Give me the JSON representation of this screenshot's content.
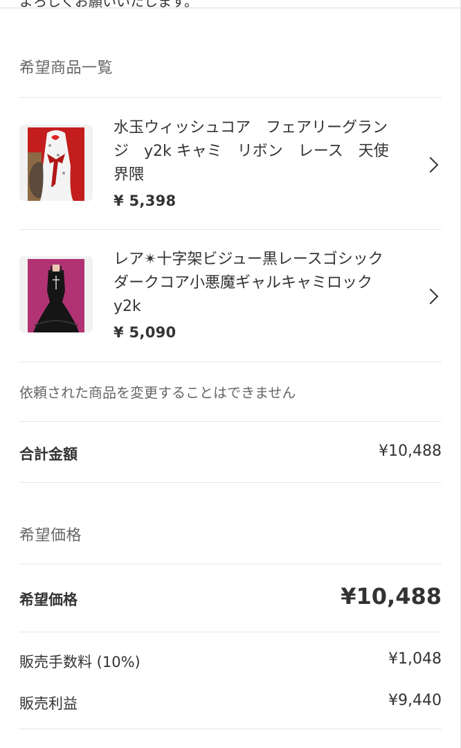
{
  "header": {
    "cut_text": "よろしくお願いいたします。"
  },
  "wishlist": {
    "title": "希望商品一覧",
    "items": [
      {
        "name": "水玉ウィッシュコア　フェアリーグランジ　y2k キャミ　リボン　レース　天使界隈",
        "price": "¥ 5,398"
      },
      {
        "name": "レア✴︎十字架ビジュー黒レースゴシックダークコア小悪魔ギャルキャミロック y2k",
        "price": "¥ 5,090"
      }
    ],
    "note": "依頼された商品を変更することはできません"
  },
  "total": {
    "label": "合計金額",
    "value": "¥10,488"
  },
  "price_section": {
    "title": "希望価格",
    "desired_label": "希望価格",
    "desired_value": "¥10,488",
    "fee_label": "販売手数料 (10%)",
    "fee_value": "¥1,048",
    "profit_label": "販売利益",
    "profit_value": "¥9,440"
  },
  "icons": {
    "chevron": "chevron-right-icon"
  },
  "colors": {
    "text": "#333333",
    "muted": "#666666",
    "divider": "#e6e6e6"
  }
}
